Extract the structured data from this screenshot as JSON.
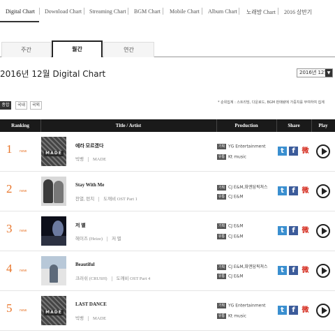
{
  "nav": {
    "items": [
      "Digital Chart",
      "Download Chart",
      "Streaming Chart",
      "BGM Chart",
      "Mobile Chart",
      "Album Chart",
      "노래방 Chart",
      "2016 상반기"
    ]
  },
  "tabs": [
    "주간",
    "월간",
    "연간"
  ],
  "title": "2016년 12월 Digital Chart",
  "date_select": {
    "value": "2016년 12월",
    "arrow": "▼"
  },
  "filters": [
    "종합",
    "국내",
    "국외"
  ],
  "note": "* 순위집계 : 스트리밍, 다운로드, BGM 판매량에 가중치를 부여하여 집계",
  "table": {
    "headers": {
      "ranking": "Ranking",
      "title_artist": "Title / Artist",
      "production": "Production",
      "share": "Share",
      "play": "Play"
    },
    "rows": [
      {
        "rank": "1",
        "change": "new",
        "song": "에라 모르겠다",
        "artist": "빅뱅",
        "album": "MADE",
        "labels": [
          {
            "tag": "기획",
            "name": "YG Entertainment"
          },
          {
            "tag": "유통",
            "name": "Kt music"
          }
        ]
      },
      {
        "rank": "2",
        "change": "new",
        "song": "Stay With Me",
        "artist": "찬열, 펀치",
        "album": "도깨비 OST Part 1",
        "labels": [
          {
            "tag": "기획",
            "name": "CJ E&M,화앤담픽쳐스"
          },
          {
            "tag": "유통",
            "name": "CJ E&M"
          }
        ]
      },
      {
        "rank": "3",
        "change": "new",
        "song": "저 별",
        "artist": "헤이즈 (Heize)",
        "album": "저 별",
        "labels": [
          {
            "tag": "기획",
            "name": "CJ E&M"
          },
          {
            "tag": "유통",
            "name": "CJ E&M"
          }
        ]
      },
      {
        "rank": "4",
        "change": "new",
        "song": "Beautiful",
        "artist": "크러쉬 (CRUSH)",
        "album": "도깨비 OST Part 4",
        "labels": [
          {
            "tag": "기획",
            "name": "CJ E&M,화앤담픽쳐스"
          },
          {
            "tag": "유통",
            "name": "CJ E&M"
          }
        ]
      },
      {
        "rank": "5",
        "change": "new",
        "song": "LAST DANCE",
        "artist": "빅뱅",
        "album": "MADE",
        "labels": [
          {
            "tag": "기획",
            "name": "YG Entertainment"
          },
          {
            "tag": "유통",
            "name": "Kt music"
          }
        ]
      }
    ]
  },
  "share_icons": {
    "twitter": "t",
    "facebook": "f",
    "weibo": "微"
  },
  "colors": {
    "rank": "#e8752a",
    "header_bg": "#1a1a1a",
    "twitter": "#3a8fd0",
    "facebook": "#3b5b9a",
    "weibo": "#d52b1e"
  },
  "cover_text": {
    "made": "MADE"
  }
}
